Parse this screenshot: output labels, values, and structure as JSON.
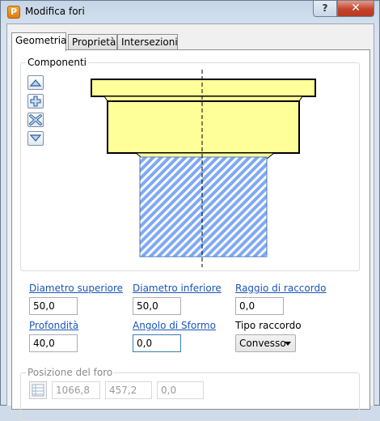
{
  "window": {
    "title": "Modifica fori",
    "app_icon_letter": "P",
    "help_label": "?",
    "close_label": "✕"
  },
  "tabs": [
    {
      "label": "Geometria",
      "active": true
    },
    {
      "label": "Proprietà",
      "active": false
    },
    {
      "label": "Intersezioni",
      "active": false
    }
  ],
  "components": {
    "legend": "Componenti",
    "buttons": [
      "move-up-icon",
      "add-icon",
      "delete-icon",
      "move-down-icon"
    ]
  },
  "fields": {
    "diametro_superiore": {
      "label": "Diametro superiore",
      "value": "50,0"
    },
    "diametro_inferiore": {
      "label": "Diametro inferiore",
      "value": "50,0"
    },
    "raggio_di_raccordo": {
      "label": "Raggio di raccordo",
      "value": "0,0"
    },
    "profondita": {
      "label": "Profondità",
      "value": "40,0"
    },
    "angolo_di_sformo": {
      "label": "Angolo di Sformo",
      "value": "0,0"
    },
    "tipo_raccordo": {
      "label": "Tipo raccordo",
      "value": "Convesso"
    }
  },
  "position": {
    "legend": "Posizione del foro",
    "x": "1066,8",
    "y": "457,2",
    "z": "0,0"
  },
  "colors": {
    "preview_fill": "#ffff99",
    "hatch_fill": "#7faaf0",
    "link": "#1a55b8"
  }
}
